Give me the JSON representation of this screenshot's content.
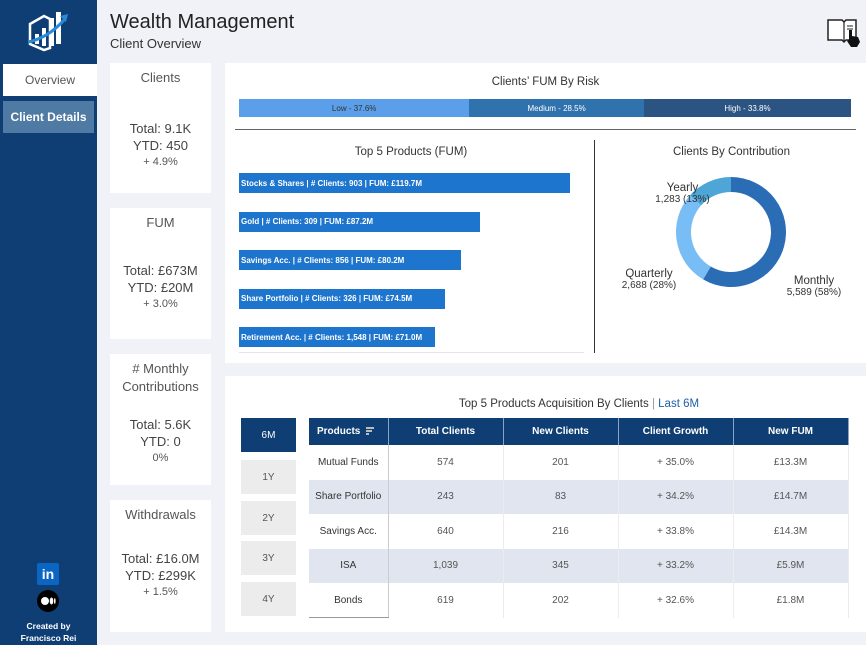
{
  "sidebar": {
    "nav": [
      {
        "label": "Overview",
        "active": true
      },
      {
        "label": "Client Details",
        "active": false
      }
    ],
    "social_icons": [
      "linkedin-icon",
      "medium-icon"
    ],
    "linkedin_glyph": "in",
    "credit_line1": "Created by",
    "credit_line2": "Francisco Rei"
  },
  "header": {
    "title": "Wealth Management",
    "subtitle": "Client Overview",
    "help_icon": "book-pointer-icon"
  },
  "kpis": [
    {
      "title": "Clients",
      "total": "Total: 9.1K",
      "ytd": "YTD: 450",
      "change": "+ 4.9%"
    },
    {
      "title": "FUM",
      "total": "Total: £673M",
      "ytd": "YTD: £20M",
      "change": "+ 3.0%"
    },
    {
      "title": "# Monthly Contributions",
      "total": "Total: 5.6K",
      "ytd": "YTD: 0",
      "change": "0%"
    },
    {
      "title": "Withdrawals",
      "total": "Total: £16.0M",
      "ytd": "YTD: £299K",
      "change": "+ 1.5%"
    }
  ],
  "chart_data": [
    {
      "type": "bar",
      "title": "Clients’ FUM By Risk",
      "orientation": "stacked-horizontal",
      "categories": [
        "Low",
        "Medium",
        "High"
      ],
      "values": [
        37.6,
        28.5,
        33.8
      ],
      "labels": [
        "Low - 37.6%",
        "Medium - 28.5%",
        "High - 33.8%"
      ],
      "colors": [
        "#5b9ee9",
        "#2f72ad",
        "#2b5482"
      ],
      "unit": "%"
    },
    {
      "type": "bar",
      "title": "Top 5 Products (FUM)",
      "orientation": "horizontal",
      "categories": [
        "Stocks & Shares",
        "Gold",
        "Savings Acc.",
        "Share Portfolio",
        "Retirement Acc."
      ],
      "clients": [
        903,
        309,
        856,
        326,
        1548
      ],
      "values": [
        119.7,
        87.2,
        80.2,
        74.5,
        71.0
      ],
      "labels": [
        "Stocks & Shares | # Clients: 903 | FUM: £119.7M",
        "Gold | # Clients: 309 | FUM: £87.2M",
        "Savings Acc. | # Clients: 856 | FUM: £80.2M",
        "Share Portfolio | # Clients: 326 | FUM: £74.5M",
        "Retirement Acc. | # Clients: 1,548 | FUM: £71.0M"
      ],
      "unit": "£M",
      "color": "#1e75cd"
    },
    {
      "type": "pie",
      "title": "Clients By Contribution",
      "donut": true,
      "categories": [
        "Monthly",
        "Quarterly",
        "Yearly"
      ],
      "values": [
        5589,
        2688,
        1283
      ],
      "value_labels": [
        "5,589 (58%)",
        "2,688 (28%)",
        "1,283 (13%)"
      ],
      "colors": [
        "#2a6db5",
        "#79bdf7",
        "#4ea6d6"
      ]
    }
  ],
  "acquisition": {
    "title": "Top 5 Products Acquisition By Clients",
    "separator": " | ",
    "period_label": "Last 6M",
    "period_color": "#1f5fa8",
    "periods": [
      {
        "label": "6M",
        "active": true
      },
      {
        "label": "1Y",
        "active": false
      },
      {
        "label": "2Y",
        "active": false
      },
      {
        "label": "3Y",
        "active": false
      },
      {
        "label": "4Y",
        "active": false
      }
    ],
    "columns": [
      "Products",
      "Total Clients",
      "New Clients",
      "Client Growth",
      "New FUM"
    ],
    "rows": [
      [
        "Mutual Funds",
        "574",
        "201",
        "+ 35.0%",
        "£13.3M"
      ],
      [
        "Share Portfolio",
        "243",
        "83",
        "+ 34.2%",
        "£14.7M"
      ],
      [
        "Savings Acc.",
        "640",
        "216",
        "+ 33.8%",
        "£14.3M"
      ],
      [
        "ISA",
        "1,039",
        "345",
        "+ 33.2%",
        "£5.9M"
      ],
      [
        "Bonds",
        "619",
        "202",
        "+ 32.6%",
        "£1.8M"
      ]
    ]
  },
  "colors": {
    "brand_navy": "#0e3e74",
    "nav_inactive": "#4e7aa3",
    "row_alt": "#e1e5ef",
    "background": "#f0f2f7"
  }
}
